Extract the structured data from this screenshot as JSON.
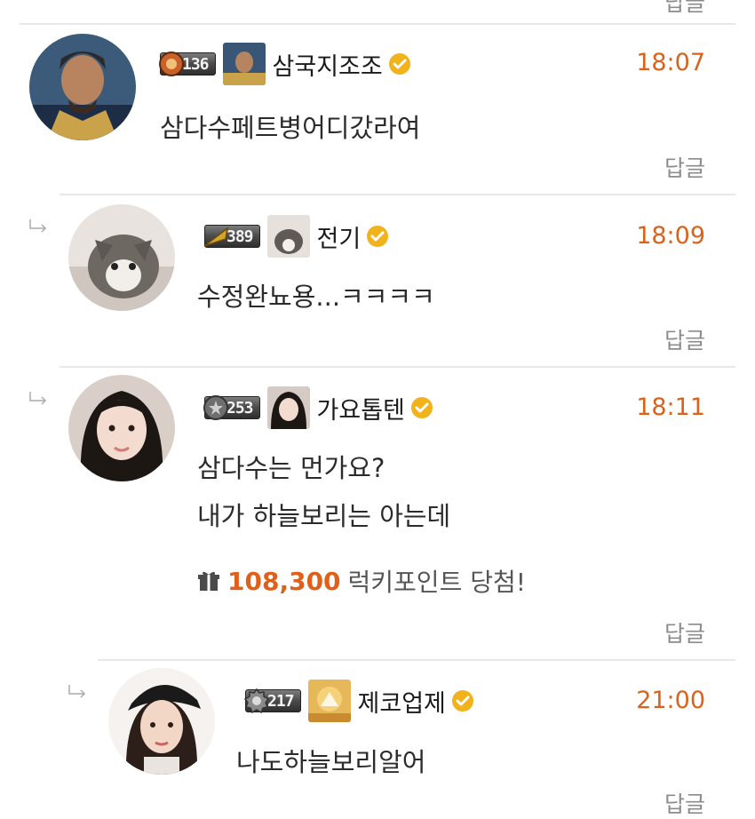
{
  "top_partial": {
    "reply_label": "답글"
  },
  "comments": [
    {
      "id": "c1",
      "level": "136",
      "nickname": "삼국지조조",
      "time": "18:07",
      "lines": [
        "삼다수페트병어디갔라여"
      ],
      "reply_label": "답글"
    },
    {
      "id": "c2",
      "level": "389",
      "nickname": "전기",
      "time": "18:09",
      "lines": [
        "수정완뇨용...ㅋㅋㅋㅋ"
      ],
      "reply_label": "답글"
    },
    {
      "id": "c3",
      "level": "253",
      "nickname": "가요톱텐",
      "time": "18:11",
      "lines": [
        "삼다수는 먼가요?",
        "내가 하늘보리는 아는데"
      ],
      "lucky": {
        "points": "108,300",
        "message": "럭키포인트 당첨!"
      },
      "reply_label": "답글"
    },
    {
      "id": "c4",
      "level": "217",
      "nickname": "제코업제",
      "time": "21:00",
      "lines": [
        "나도하늘보리알어"
      ],
      "reply_label": "답글"
    }
  ],
  "colors": {
    "accent": "#d9621c",
    "verified": "#f2b21c",
    "separator": "#e8e8e8"
  },
  "icons": {
    "verified": "check-badge-icon",
    "reply_arrow": "reply-arrow-icon",
    "gift": "gift-icon"
  }
}
